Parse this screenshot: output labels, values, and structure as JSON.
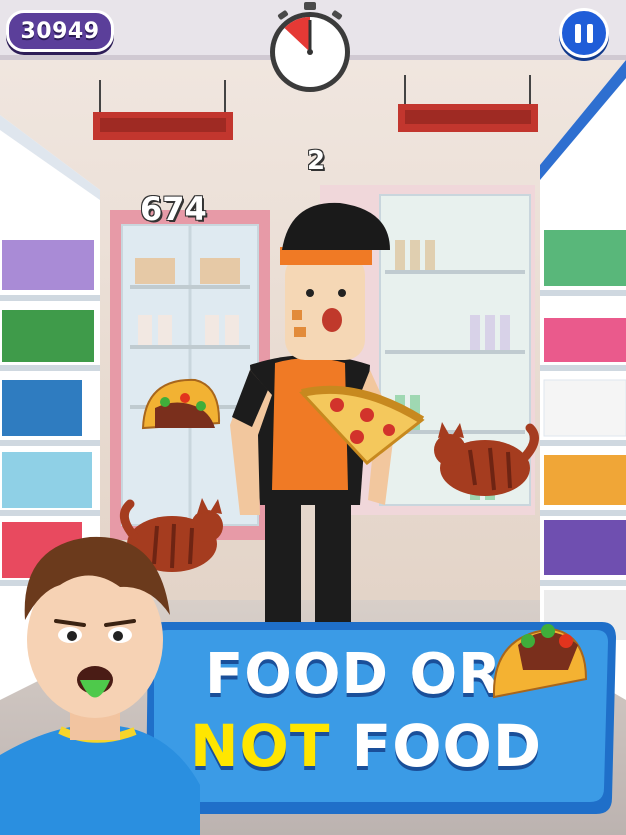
{
  "hud": {
    "score": "30949",
    "timer_fraction_remaining": 0.13,
    "pause_icon": "pause-icon"
  },
  "floating_points": {
    "big": "674",
    "small": "2"
  },
  "banner": {
    "line1_part1": "FOOD",
    "line1_part2": "OR",
    "line2_part1": "NOT",
    "line2_part2": "FOOD"
  },
  "items": [
    {
      "name": "taco",
      "kind": "food"
    },
    {
      "name": "pizza-slice",
      "kind": "food"
    },
    {
      "name": "cat",
      "kind": "not-food"
    },
    {
      "name": "cat",
      "kind": "not-food"
    }
  ],
  "colors": {
    "score_pill": "#5b3f9a",
    "pause_button": "#1f5dd8",
    "banner_blue": "#2b7fd4",
    "not_yellow": "#ffe600",
    "timer_red": "#e53935"
  }
}
